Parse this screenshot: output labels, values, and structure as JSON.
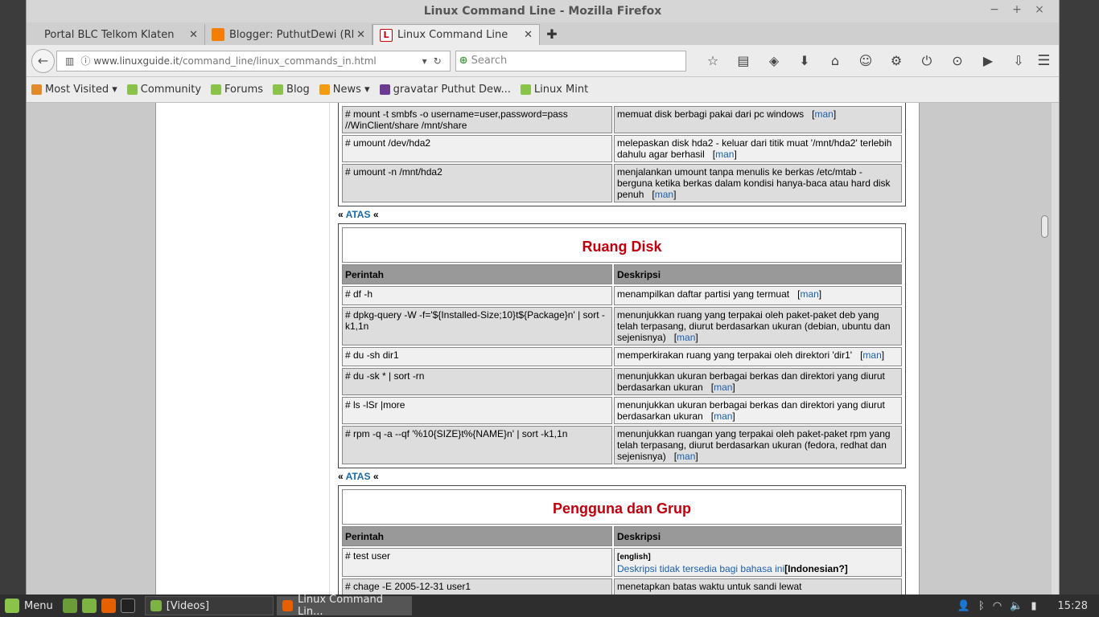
{
  "window": {
    "title": "Linux Command Line - Mozilla Firefox",
    "controls": [
      "−",
      "+",
      "×"
    ]
  },
  "tabs": [
    {
      "label": "Portal BLC Telkom Klaten",
      "icon": "page-icon",
      "active": false
    },
    {
      "label": "Blogger: PuthutDewi (RPL...",
      "icon": "blogger-icon",
      "active": false
    },
    {
      "label": "Linux Command Line",
      "icon": "linuxguide-icon",
      "active": true
    }
  ],
  "nav": {
    "url_host": "www.linuxguide.it",
    "url_path": "/command_line/linux_commands_in.html",
    "search_placeholder": "Search"
  },
  "bookmarks": [
    {
      "label": "Most Visited ▾",
      "icon": "most-visited-icon"
    },
    {
      "label": "Community",
      "icon": "mint-icon"
    },
    {
      "label": "Forums",
      "icon": "mint-icon"
    },
    {
      "label": "Blog",
      "icon": "mint-icon"
    },
    {
      "label": "News ▾",
      "icon": "rss-icon"
    },
    {
      "label": "gravatar Puthut Dew...",
      "icon": "gravatar-icon"
    },
    {
      "label": "Linux Mint",
      "icon": "mint-icon"
    }
  ],
  "page": {
    "atas_prefix": "«",
    "atas_label": "ATAS",
    "atas_suffix": "«",
    "col_cmd": "Perintah",
    "col_desc": "Deskripsi",
    "man": "man",
    "mount_rows": [
      {
        "cmd": "# mount -t smbfs -o username=user,password=pass //WinClient/share /mnt/share",
        "desc": "memuat disk berbagi pakai dari pc windows"
      },
      {
        "cmd": "# umount /dev/hda2",
        "desc": "melepaskan disk hda2 - keluar dari titik muat '/mnt/hda2' terlebih dahulu agar berhasil"
      },
      {
        "cmd": "# umount -n /mnt/hda2",
        "desc": "menjalankan umount tanpa menulis ke berkas /etc/mtab - berguna ketika berkas dalam kondisi hanya-baca atau hard disk penuh"
      }
    ],
    "ruang_title": "Ruang Disk",
    "ruang_rows": [
      {
        "cmd": "# df -h",
        "desc": "menampilkan daftar partisi yang termuat"
      },
      {
        "cmd": "# dpkg-query -W -f='${Installed-Size;10}t${Package}n' | sort -k1,1n",
        "desc": "menunjukkan ruang yang terpakai oleh paket-paket deb yang telah terpasang, diurut berdasarkan ukuran (debian, ubuntu dan sejenisnya)"
      },
      {
        "cmd": "# du -sh dir1",
        "desc": "memperkirakan ruang yang terpakai oleh direktori 'dir1'"
      },
      {
        "cmd": "# du -sk * | sort -rn",
        "desc": "menunjukkan ukuran berbagai berkas dan direktori yang diurut berdasarkan ukuran"
      },
      {
        "cmd": "# ls -lSr |more",
        "desc": "menunjukkan ukuran berbagai berkas dan direktori yang diurut berdasarkan ukuran"
      },
      {
        "cmd": "# rpm -q -a --qf '%10{SIZE}t%{NAME}n' | sort -k1,1n",
        "desc": "menunjukkan ruangan yang terpakai oleh paket-paket rpm yang telah terpasang, diurut berdasarkan ukuran (fedora, redhat dan sejenisnya)"
      }
    ],
    "grup_title": "Pengguna dan Grup",
    "grup_rows": [
      {
        "cmd": "# test user",
        "eng": "[english]",
        "link": "Deskripsi tidak tersedia bagi bahasa ini",
        "lang": "[Indonesian?]"
      },
      {
        "cmd": "# chage -E 2005-12-31 user1",
        "desc": "menetapkan batas waktu untuk sandi lewat"
      }
    ]
  },
  "taskbar": {
    "menu": "Menu",
    "tasks": [
      {
        "label": "[Videos]",
        "icon": "folder-icon",
        "active": false
      },
      {
        "label": "Linux Command Lin...",
        "icon": "firefox-icon",
        "active": true
      }
    ],
    "clock": "15:28"
  }
}
